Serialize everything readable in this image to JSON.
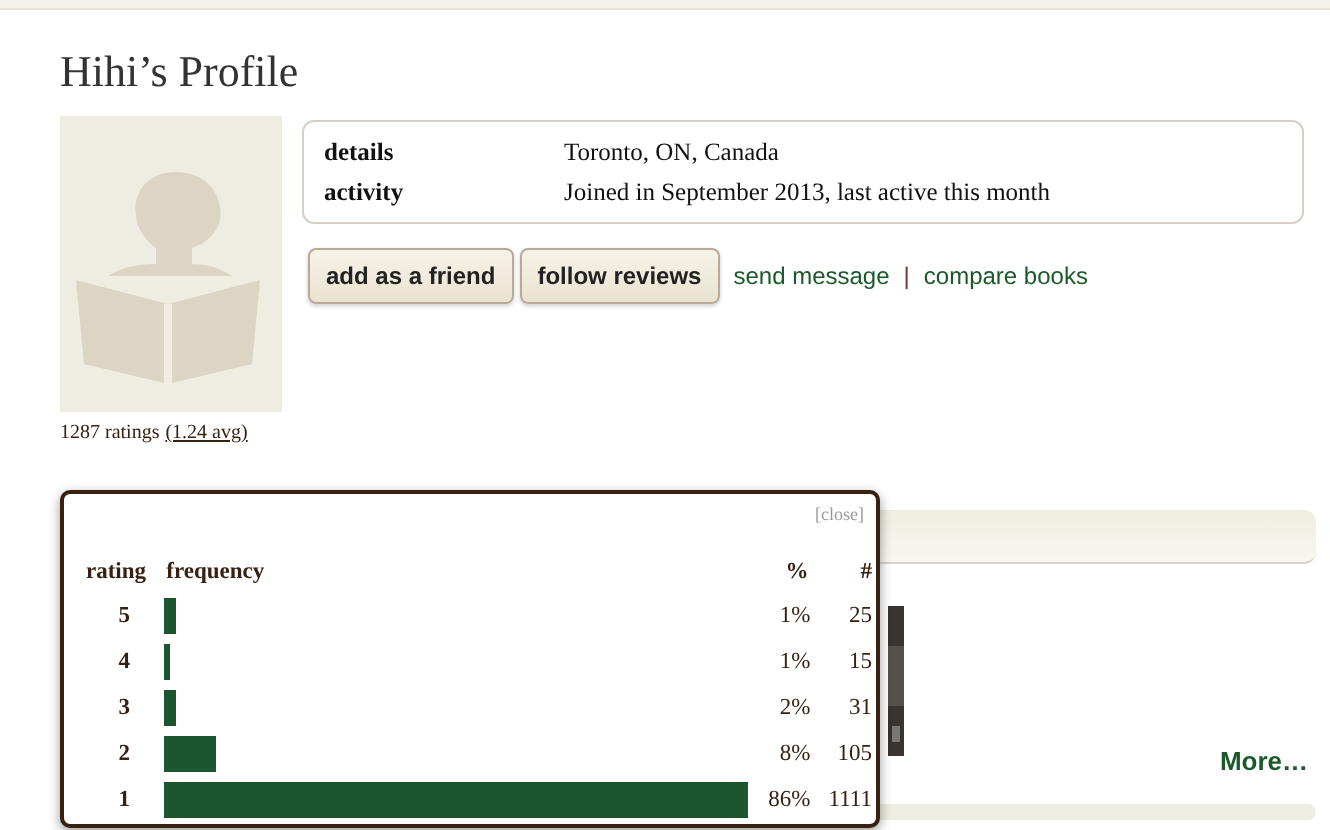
{
  "title": "Hihi’s Profile",
  "details": [
    {
      "label": "details",
      "value": "Toronto, ON, Canada"
    },
    {
      "label": "activity",
      "value": "Joined in September 2013, last active this month"
    }
  ],
  "buttons": [
    "add as a friend",
    "follow reviews"
  ],
  "links": [
    "send message",
    "compare books"
  ],
  "link_separator": "|",
  "ratings": {
    "count": "1287 ratings",
    "average": "(1.24 avg)"
  },
  "popup": {
    "close": "[close]",
    "columns": [
      "rating",
      "frequency",
      "%",
      "#"
    ],
    "rows": [
      {
        "rating": "5",
        "level": 0.02,
        "percent": "1%",
        "count": "25"
      },
      {
        "rating": "4",
        "level": 0.01,
        "percent": "1%",
        "count": "15"
      },
      {
        "rating": "3",
        "level": 0.02,
        "percent": "2%",
        "count": "31"
      },
      {
        "rating": "2",
        "level": 0.09,
        "percent": "8%",
        "count": "105"
      },
      {
        "rating": "1",
        "level": 1.0,
        "percent": "86%",
        "count": "1111"
      }
    ]
  },
  "more_link": "More…"
}
